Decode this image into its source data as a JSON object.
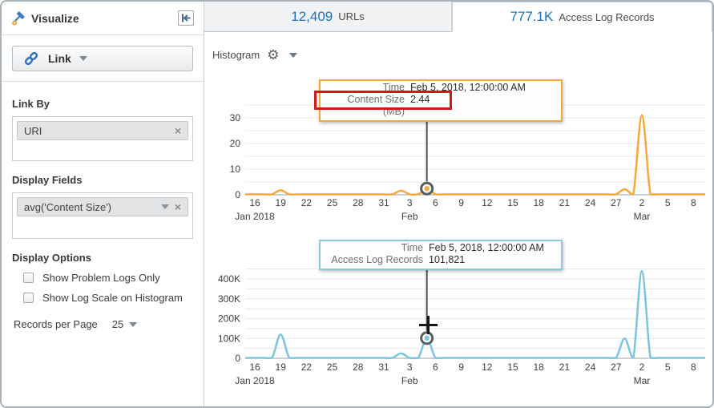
{
  "sidebar": {
    "title": "Visualize",
    "link_button_label": "Link",
    "link_by": {
      "label": "Link By",
      "chip": "URI"
    },
    "display_fields": {
      "label": "Display Fields",
      "chip": "avg('Content Size')"
    },
    "display_options": {
      "label": "Display Options",
      "checkboxes": [
        {
          "label": "Show Problem Logs Only",
          "checked": false
        },
        {
          "label": "Show Log Scale on Histogram",
          "checked": false
        }
      ]
    },
    "records_per_page": {
      "label": "Records per Page",
      "value": "25"
    }
  },
  "tabs": [
    {
      "count": "12,409",
      "label": "URLs",
      "active": false
    },
    {
      "count": "777.1K",
      "label": "Access Log Records",
      "active": true
    }
  ],
  "toolbar": {
    "view_label": "Histogram"
  },
  "tooltips": [
    {
      "rows": [
        {
          "label": "Time",
          "value": "Feb 5, 2018, 12:00:00 AM"
        },
        {
          "label": "Content Size (MB)",
          "value": "2.44"
        }
      ],
      "border_color": "#f0a63c",
      "highlighted_row": "Content Size (MB) 2.44"
    },
    {
      "rows": [
        {
          "label": "Time",
          "value": "Feb 5, 2018, 12:00:00 AM"
        },
        {
          "label": "Access Log Records",
          "value": "101,821"
        }
      ],
      "border_color": "#8cc8dc"
    }
  ],
  "chart_data": [
    {
      "type": "line",
      "title": "Content Size (MB) histogram",
      "series_name": "avg('Content Size')",
      "color": "#f5a93c",
      "x_start": "Jan 16, 2018",
      "x_end": "Mar 8, 2018",
      "x_tick_labels": [
        "16",
        "19",
        "22",
        "25",
        "28",
        "31",
        "3",
        "6",
        "9",
        "12",
        "15",
        "18",
        "21",
        "24",
        "27",
        "2",
        "5",
        "8"
      ],
      "x_months": [
        {
          "label": "Jan 2018",
          "day": 0
        },
        {
          "label": "Feb",
          "day": 18
        },
        {
          "label": "Mar",
          "day": 45
        }
      ],
      "ylim": [
        0,
        35
      ],
      "grid_step": 5,
      "y_ticks": [
        {
          "v": 0,
          "label": "0"
        },
        {
          "v": 10,
          "label": "10"
        },
        {
          "v": 20,
          "label": "20"
        },
        {
          "v": 30,
          "label": "30"
        }
      ],
      "baseline": 0.2,
      "points": [
        {
          "date": "Jan 19, 2018",
          "day": 3,
          "value": 1.8
        },
        {
          "date": "Feb 2, 2018",
          "day": 17,
          "value": 1.6
        },
        {
          "date": "Feb 5, 2018",
          "day": 20,
          "value": 2.44
        },
        {
          "date": "Feb 28, 2018",
          "day": 43,
          "value": 2.2
        },
        {
          "date": "Mar 2, 2018",
          "day": 45,
          "value": 31
        }
      ],
      "selected": {
        "date": "Feb 5, 2018, 12:00:00 AM",
        "day": 20,
        "value": 2.44
      }
    },
    {
      "type": "line",
      "title": "Access Log Records histogram",
      "series_name": "Access Log Records",
      "color": "#7cc4db",
      "x_start": "Jan 16, 2018",
      "x_end": "Mar 8, 2018",
      "x_tick_labels": [
        "16",
        "19",
        "22",
        "25",
        "28",
        "31",
        "3",
        "6",
        "9",
        "12",
        "15",
        "18",
        "21",
        "24",
        "27",
        "2",
        "5",
        "8"
      ],
      "x_months": [
        {
          "label": "Jan 2018",
          "day": 0
        },
        {
          "label": "Feb",
          "day": 18
        },
        {
          "label": "Mar",
          "day": 45
        }
      ],
      "ylim": [
        0,
        450000
      ],
      "grid_step": 50000,
      "y_ticks": [
        {
          "v": 0,
          "label": "0"
        },
        {
          "v": 100000,
          "label": "100K"
        },
        {
          "v": 200000,
          "label": "200K"
        },
        {
          "v": 300000,
          "label": "300K"
        },
        {
          "v": 400000,
          "label": "400K"
        }
      ],
      "baseline": 2000,
      "points": [
        {
          "date": "Jan 19, 2018",
          "day": 3,
          "value": 120000
        },
        {
          "date": "Feb 2, 2018",
          "day": 17,
          "value": 25000
        },
        {
          "date": "Feb 5, 2018",
          "day": 20,
          "value": 101821
        },
        {
          "date": "Feb 28, 2018",
          "day": 43,
          "value": 100000
        },
        {
          "date": "Mar 2, 2018",
          "day": 45,
          "value": 440000
        }
      ],
      "selected": {
        "date": "Feb 5, 2018, 12:00:00 AM",
        "day": 20,
        "value": 101821
      }
    }
  ]
}
